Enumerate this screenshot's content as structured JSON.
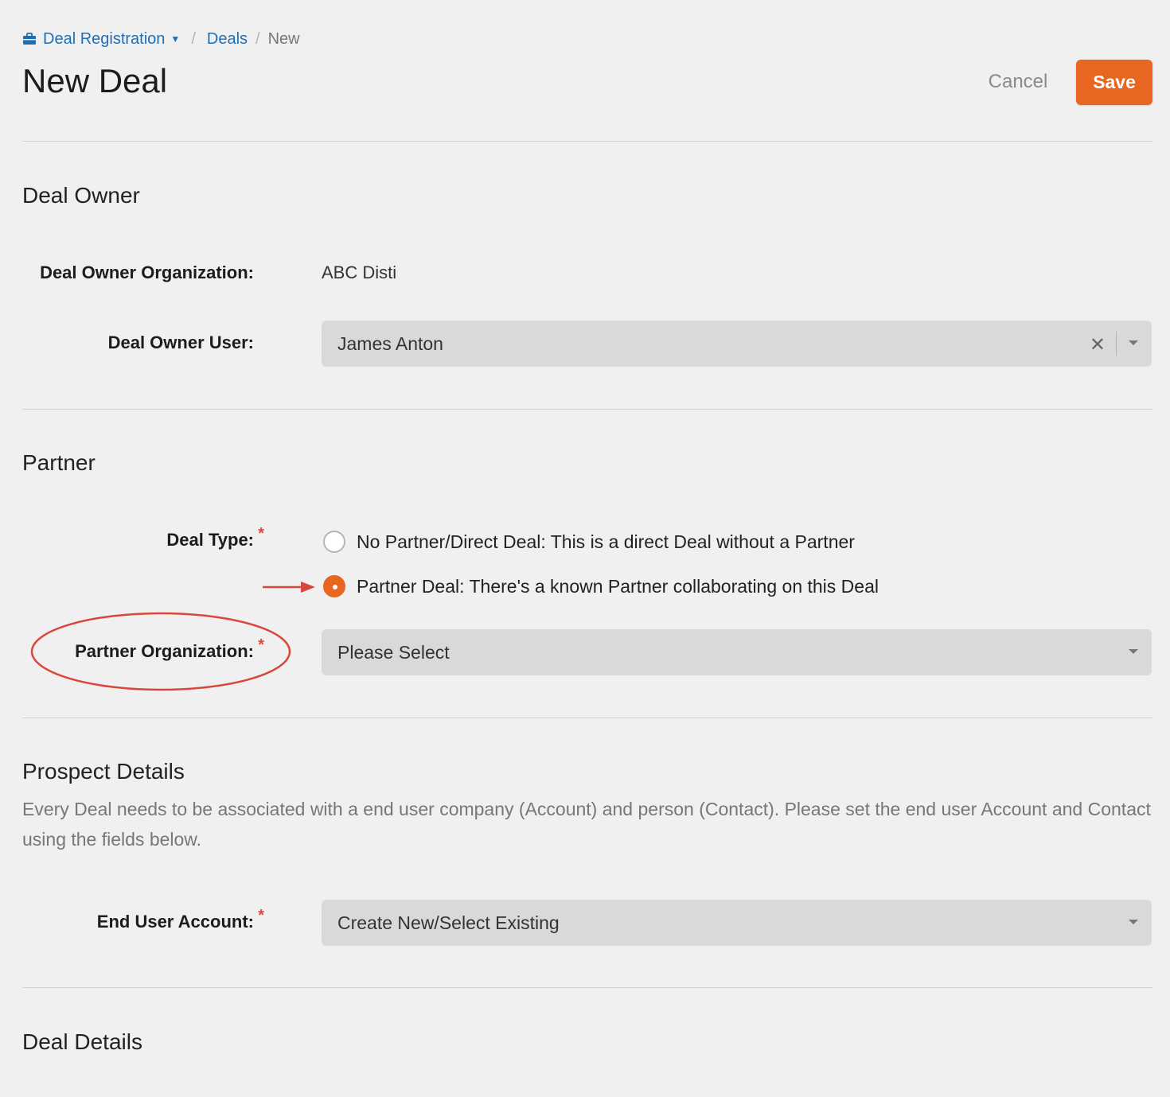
{
  "breadcrumb": {
    "app_label": "Deal Registration",
    "deals_label": "Deals",
    "current_label": "New",
    "separator": "/"
  },
  "header": {
    "title": "New Deal",
    "cancel_label": "Cancel",
    "save_label": "Save"
  },
  "sections": {
    "deal_owner": {
      "title": "Deal Owner",
      "org_label": "Deal Owner Organization:",
      "org_value": "ABC Disti",
      "user_label": "Deal Owner User:",
      "user_value": "James Anton"
    },
    "partner": {
      "title": "Partner",
      "deal_type_label": "Deal Type:",
      "option_direct": "No Partner/Direct Deal: This is a direct Deal without a Partner",
      "option_partner": "Partner Deal: There's a known Partner collaborating on this Deal",
      "selected_option": "partner",
      "partner_org_label": "Partner Organization:",
      "partner_org_placeholder": "Please Select"
    },
    "prospect": {
      "title": "Prospect Details",
      "help": "Every Deal needs to be associated with a end user company (Account) and person (Contact). Please set the end user Account and Contact using the fields below.",
      "end_user_label": "End User Account:",
      "end_user_value": "Create New/Select Existing"
    },
    "deal_details": {
      "title": "Deal Details"
    }
  },
  "required_marker": "*",
  "colors": {
    "accent": "#e8661f",
    "link": "#1f6fb5",
    "required": "#e0483c",
    "annotation": "#d9473b"
  }
}
